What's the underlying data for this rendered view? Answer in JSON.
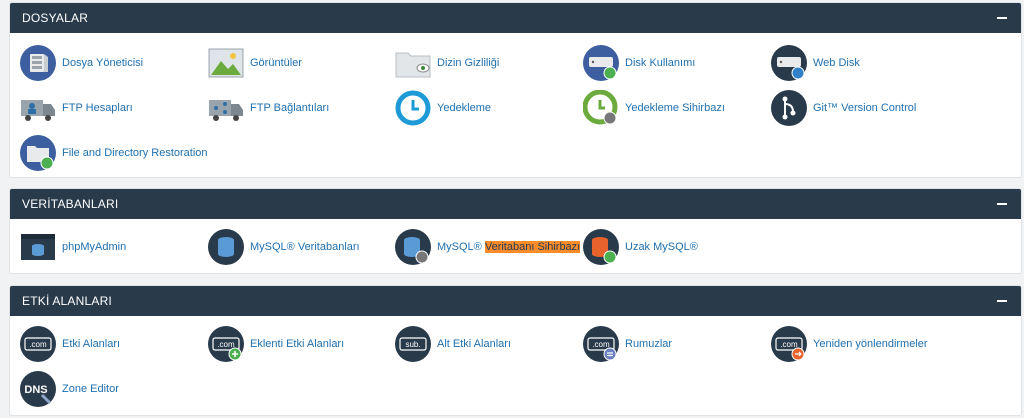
{
  "sections": [
    {
      "title": "DOSYALAR",
      "items": [
        {
          "label": "Dosya Yöneticisi",
          "icon": "file-manager-icon"
        },
        {
          "label": "Görüntüler",
          "icon": "images-icon"
        },
        {
          "label": "Dizin Gizliliği",
          "icon": "directory-privacy-icon"
        },
        {
          "label": "Disk Kullanımı",
          "icon": "disk-usage-icon"
        },
        {
          "label": "Web Disk",
          "icon": "web-disk-icon"
        },
        {
          "label": "FTP Hesapları",
          "icon": "ftp-accounts-icon"
        },
        {
          "label": "FTP Bağlantıları",
          "icon": "ftp-connections-icon"
        },
        {
          "label": "Yedekleme",
          "icon": "backup-icon"
        },
        {
          "label": "Yedekleme Sihirbazı",
          "icon": "backup-wizard-icon"
        },
        {
          "label": "Git™ Version Control",
          "icon": "git-icon"
        },
        {
          "label": "File and Directory Restoration",
          "icon": "file-restore-icon"
        }
      ]
    },
    {
      "title": "VERİTABANLARI",
      "items": [
        {
          "label": "phpMyAdmin",
          "icon": "phpmyadmin-icon"
        },
        {
          "label": "MySQL® Veritabanları",
          "icon": "mysql-databases-icon"
        },
        {
          "label_prefix": "MySQL® ",
          "label_highlight": "Veritabanı Sihirbazı",
          "icon": "mysql-wizard-icon"
        },
        {
          "label": "Uzak MySQL®",
          "icon": "remote-mysql-icon"
        }
      ]
    },
    {
      "title": "ETKİ ALANLARI",
      "items": [
        {
          "label": "Etki Alanları",
          "icon": "domains-icon",
          "badge": ".com"
        },
        {
          "label": "Eklenti Etki Alanları",
          "icon": "addon-domains-icon",
          "badge": ".com"
        },
        {
          "label": "Alt Etki Alanları",
          "icon": "subdomains-icon",
          "badge": "sub."
        },
        {
          "label": "Rumuzlar",
          "icon": "aliases-icon",
          "badge": ".com"
        },
        {
          "label": "Yeniden yönlendirmeler",
          "icon": "redirects-icon",
          "badge": ".com"
        },
        {
          "label": "Zone Editor",
          "icon": "zone-editor-icon",
          "badge": "DNS"
        }
      ]
    }
  ],
  "colors": {
    "header": "#293a4a",
    "link": "#1f6fae",
    "highlight": "#ff8c2a"
  }
}
